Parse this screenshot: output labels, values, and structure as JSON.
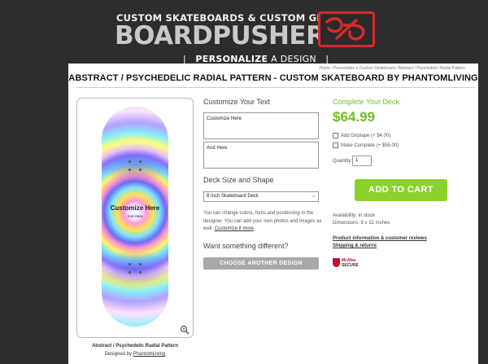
{
  "header": {
    "tagline": "CUSTOM SKATEBOARDS & CUSTOM GRIPTAPE",
    "brand": "BOARDPUSHER",
    "nav_separator_left": "|",
    "nav_strong": "PERSONALIZE",
    "nav_rest": "A DESIGN",
    "nav_separator_right": "|"
  },
  "breadcrumb": "Home / Personalize a Custom Skateboard / Abstract / Psychedelic Radial Pattern",
  "page_title": "ABSTRACT / PSYCHEDELIC RADIAL PATTERN - CUSTOM SKATEBOARD BY PHANTOMLIVING",
  "preview": {
    "deck_text_line1": "Customize Here",
    "deck_text_line2": "And Here",
    "caption": "Abstract / Psychedelic Radial Pattern",
    "designed_by_prefix": "Designed by",
    "designer": "PhantomLiving"
  },
  "customize": {
    "heading": "Customize Your Text",
    "field1_value": "Customize Here",
    "field2_value": "And Here"
  },
  "deck": {
    "heading": "Deck Size and Shape",
    "selected": "8 Inch Skateboard Deck",
    "help_text": "You can change colors, fonts and positioning in the designer. You can add your own photos and images as well.",
    "help_link": "Customize it more"
  },
  "different": {
    "heading": "Want something different?",
    "button": "CHOOSE ANOTHER DESIGN"
  },
  "order": {
    "heading": "Complete Your Deck",
    "price": "$64.99",
    "option1": "Add Griptape (+ $4.00)",
    "option2": "Make Complete (+ $55.00)",
    "quantity_label": "Quantity:",
    "quantity_value": "1",
    "cart_button": "ADD TO CART",
    "availability": "Availability: in stock",
    "dimensions": "Dimensions: 8 x 32 Inches",
    "info_link": "Product information & customer reviews",
    "shipping_link": "Shipping & returns",
    "badge_brand": "McAfee",
    "badge_label": "SECURE"
  },
  "colors": {
    "price_green": "#6cbf25",
    "cart_green": "#8ad12c",
    "brand_red": "#d42a2a"
  }
}
